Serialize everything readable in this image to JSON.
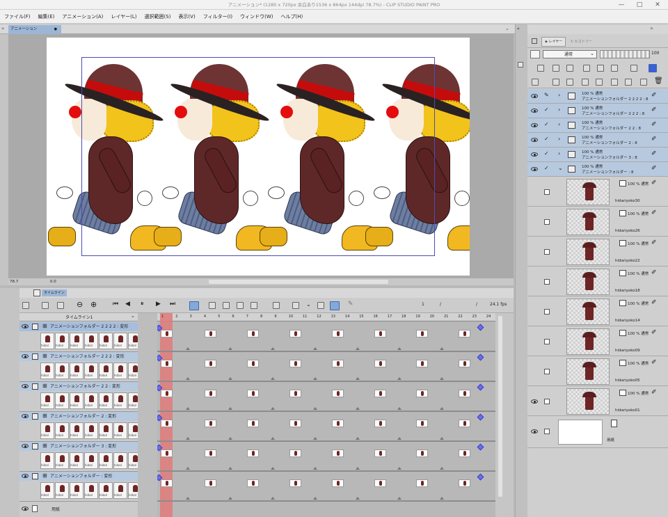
{
  "window": {
    "title": "アニメーション* (1280 x 720px 余白あり1536 x 864px 144dpi 78.7%)  - CLIP STUDIO PAINT PRO",
    "controls": [
      "—",
      "□",
      "✕"
    ]
  },
  "menu": [
    "ファイル(F)",
    "編集(E)",
    "アニメーション(A)",
    "レイヤー(L)",
    "選択範囲(S)",
    "表示(V)",
    "フィルター(I)",
    "ウィンドウ(W)",
    "ヘルプ(H)"
  ],
  "canvas": {
    "tab_label": "アニメーション",
    "tab_close": "●",
    "status_zoom": "78.7",
    "status_angle": "0.0"
  },
  "timeline": {
    "tab_label": "タイムライン",
    "selector": "タイムライン1",
    "current_frame": "1",
    "slash1": "/",
    "slash2": "/",
    "fps": "24.1 fps",
    "frame_numbers": [
      "1",
      "2",
      "3",
      "4",
      "5",
      "6",
      "7",
      "8",
      "9",
      "10",
      "11",
      "12",
      "13",
      "14",
      "15",
      "16",
      "17",
      "18",
      "19",
      "20",
      "21",
      "22",
      "23",
      "24"
    ],
    "layers": [
      {
        "name": "アニメーションフォルダー 2 2 2 2 : 変形"
      },
      {
        "name": "アニメーションフォルダー 2 2 2 : 変形"
      },
      {
        "name": "アニメーションフォルダー 2 2 : 変形"
      },
      {
        "name": "アニメーションフォルダー 2 : 変形"
      },
      {
        "name": "アニメーションフォルダー 3 : 変形"
      },
      {
        "name": "アニメーションフォルダー : 変形"
      }
    ],
    "thumb_label": "hidari",
    "paper_layer": "用紙"
  },
  "layer_panel": {
    "tab_layer": "レイヤー",
    "tab_other": "ヒストリー",
    "blend_mode": "通常",
    "opacity": "100",
    "folders": [
      {
        "line1": "100 % 通常",
        "line2": "アニメーションフォルダー 2 2 2 2 : 8"
      },
      {
        "line1": "100 % 通常",
        "line2": "アニメーションフォルダー 2 2 2 : 8"
      },
      {
        "line1": "100 % 通常",
        "line2": "アニメーションフォルダー 2 2 : 8"
      },
      {
        "line1": "100 % 通常",
        "line2": "アニメーションフォルダー 2 : 8"
      },
      {
        "line1": "100 % 通常",
        "line2": "アニメーションフォルダー 3 : 8"
      },
      {
        "line1": "100 % 通常",
        "line2": "アニメーションフォルダー : 8"
      }
    ],
    "cels": [
      {
        "mode": "100 % 通常",
        "name": "hidariyoko30"
      },
      {
        "mode": "100 % 通常",
        "name": "hidariyoko26"
      },
      {
        "mode": "100 % 通常",
        "name": "hidariyoko22"
      },
      {
        "mode": "100 % 通常",
        "name": "hidariyoko18"
      },
      {
        "mode": "100 % 通常",
        "name": "hidariyoko14"
      },
      {
        "mode": "100 % 通常",
        "name": "hidariyoko09"
      },
      {
        "mode": "100 % 通常",
        "name": "hidariyoko05"
      },
      {
        "mode": "100 % 通常",
        "name": "hidariyoko01"
      }
    ],
    "paper": {
      "name": "用紙"
    }
  },
  "colors": {
    "selection_blue": "#b7c9df",
    "playhead": "#e07a7a",
    "keyframe": "#6a6ef0",
    "hat_band": "#c40c0c"
  }
}
